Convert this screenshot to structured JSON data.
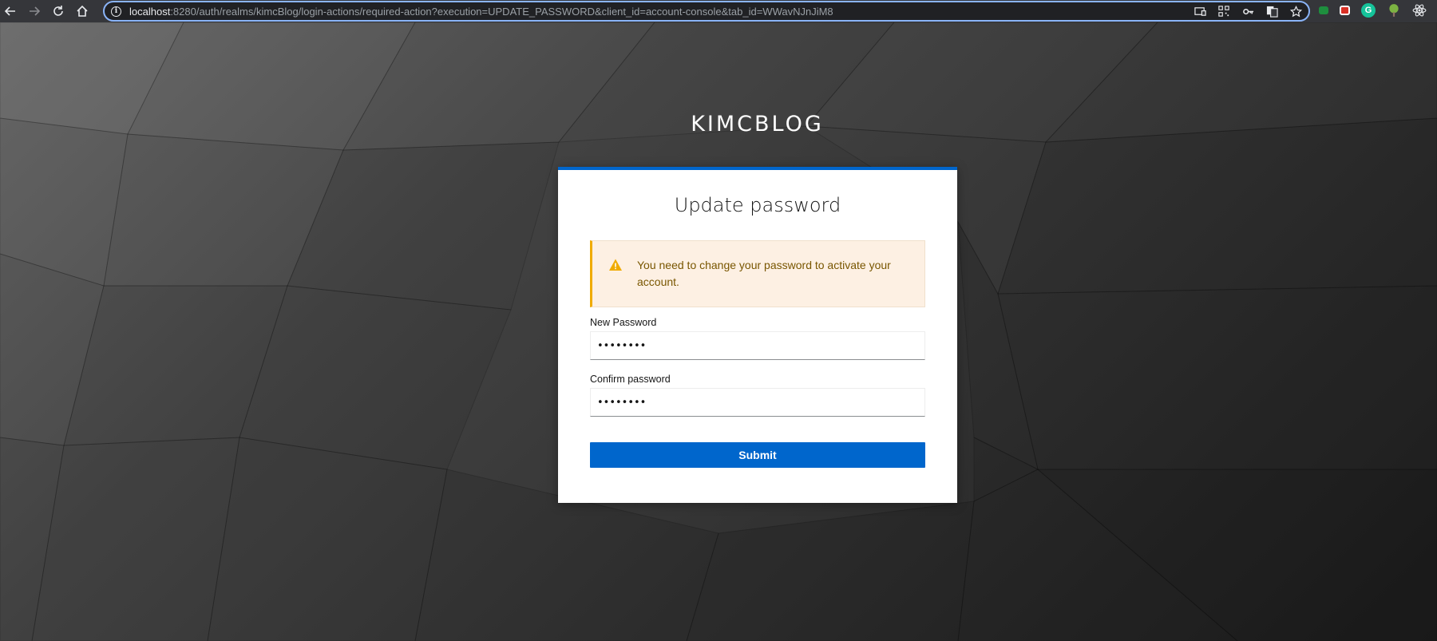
{
  "browser": {
    "url_host": "localhost",
    "url_rest": ":8280/auth/realms/kimcBlog/login-actions/required-action?execution=UPDATE_PASSWORD&client_id=account-console&tab_id=WWavNJnJiM8",
    "nav_icons": [
      "back-icon",
      "forward-icon",
      "reload-icon",
      "home-icon"
    ],
    "url_icons": [
      "cast-icon",
      "qr-code-icon",
      "key-icon",
      "translate-icon",
      "star-icon"
    ],
    "extension_icons": [
      "extension-green-icon",
      "extension-calendar-icon",
      "grammarly-icon",
      "tree-icon",
      "react-icon"
    ]
  },
  "realm": {
    "title": "KIMCBLOG"
  },
  "card": {
    "title": "Update password",
    "alert": {
      "icon": "warning-icon",
      "message": "You need to change your password to activate your account."
    },
    "new_password": {
      "label": "New Password",
      "value": "••••••••"
    },
    "confirm_password": {
      "label": "Confirm password",
      "value": "••••••••"
    },
    "submit_label": "Submit"
  },
  "colors": {
    "primary": "#0066cc",
    "warning": "#f0ab00",
    "alert_bg": "#fdf0e3",
    "alert_text": "#795600"
  }
}
